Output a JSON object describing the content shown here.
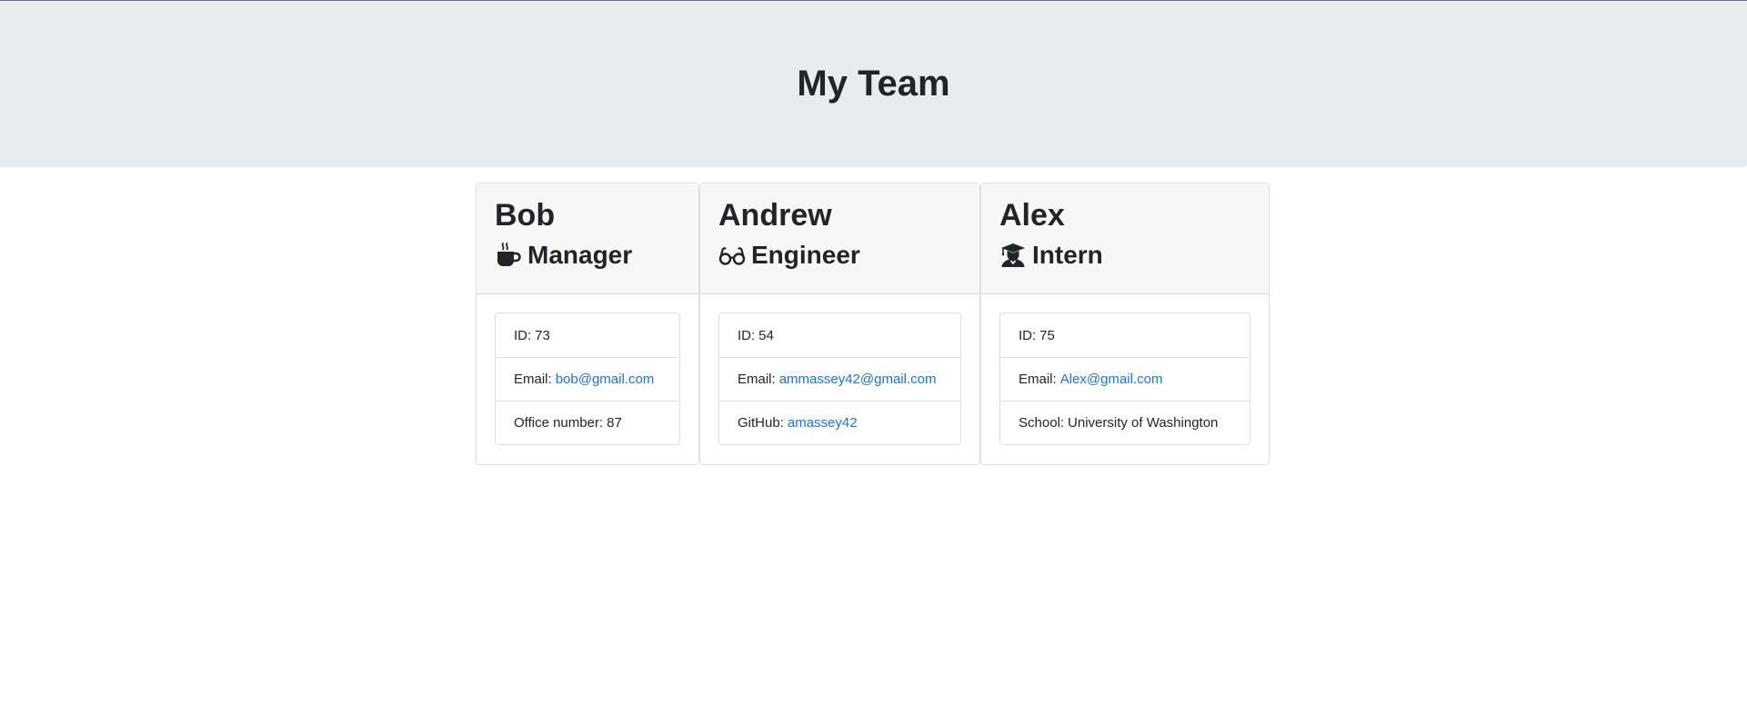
{
  "header": {
    "title": "My Team"
  },
  "team": [
    {
      "name": "Bob",
      "role": "Manager",
      "role_icon": "mug-hot-icon",
      "fields": [
        {
          "label": "ID:",
          "value": "73",
          "is_link": false
        },
        {
          "label": "Email:",
          "value": "bob@gmail.com",
          "is_link": true
        },
        {
          "label": "Office number:",
          "value": "87",
          "is_link": false
        }
      ]
    },
    {
      "name": "Andrew",
      "role": "Engineer",
      "role_icon": "glasses-icon",
      "fields": [
        {
          "label": "ID:",
          "value": "54",
          "is_link": false
        },
        {
          "label": "Email:",
          "value": "ammassey42@gmail.com",
          "is_link": true
        },
        {
          "label": "GitHub:",
          "value": "amassey42",
          "is_link": true
        }
      ]
    },
    {
      "name": "Alex",
      "role": "Intern",
      "role_icon": "graduate-icon",
      "fields": [
        {
          "label": "ID:",
          "value": "75",
          "is_link": false
        },
        {
          "label": "Email:",
          "value": "Alex@gmail.com",
          "is_link": true
        },
        {
          "label": "School:",
          "value": "University of Washington",
          "is_link": false
        }
      ]
    }
  ],
  "colors": {
    "jumbotron_bg": "#e9ecef",
    "card_header_bg": "#f7f7f7",
    "link": "#1a73e8",
    "text": "#212529"
  }
}
